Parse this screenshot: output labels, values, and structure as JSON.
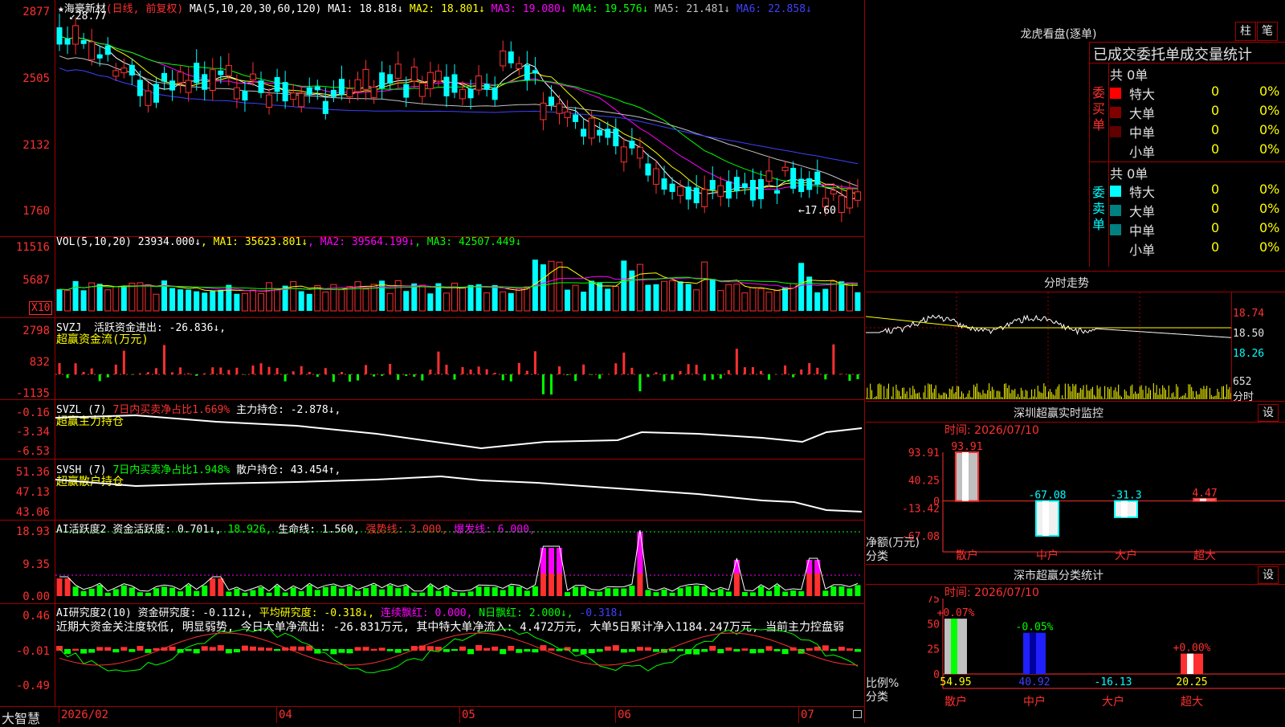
{
  "stock": {
    "name": "海豪新材",
    "period_note": "(日线, 前复权)",
    "star": "★"
  },
  "main_chart": {
    "ma_header": "MA(5,10,20,30,60,120)",
    "ma_values": [
      {
        "label": "MA1:",
        "value": "18.818↓",
        "color": "#ffffff"
      },
      {
        "label": "MA2:",
        "value": "18.801↓",
        "color": "#ffff00"
      },
      {
        "label": "MA3:",
        "value": "19.080↓",
        "color": "#ff00ff"
      },
      {
        "label": "MA4:",
        "value": "19.576↓",
        "color": "#00ff00"
      },
      {
        "label": "MA5:",
        "value": "21.481↓",
        "color": "#c0c0c0"
      },
      {
        "label": "MA6:",
        "value": "22.858↓",
        "color": "#4040ff"
      }
    ],
    "y_ticks": [
      "2877",
      "2505",
      "2132",
      "1760"
    ],
    "high_label": "28.77",
    "low_label": "17.60"
  },
  "vol_panel": {
    "header": "VOL(5,10,20)",
    "value": "23934.000↓",
    "ma": [
      {
        "label": "MA1:",
        "value": "35623.801↓",
        "color": "#ffff00"
      },
      {
        "label": "MA2:",
        "value": "39564.199↓",
        "color": "#ff00ff"
      },
      {
        "label": "MA3:",
        "value": "42507.449↓",
        "color": "#00ff00"
      }
    ],
    "y_ticks": [
      "11516",
      "5687"
    ],
    "unit": "X10"
  },
  "svzj_panel": {
    "header": "SVZJ",
    "line1": "活跃资金进出: -26.836↓,",
    "line2": "超赢资金流(万元)",
    "y_ticks": [
      "2798",
      "832",
      "-1135"
    ]
  },
  "svzl_panel": {
    "header": "SVZL (7)",
    "green_text": "7日内买卖净占比1.669%",
    "white_text": "主力持仓: -2.878↓,",
    "line2": "超赢主力持仓",
    "y_ticks": [
      "-0.16",
      "-3.34",
      "-6.53"
    ]
  },
  "svsh_panel": {
    "header": "SVSH (7)",
    "green_text": "7日内买卖净占比1.948%",
    "white_text": "散户持仓: 43.454↑,",
    "line2": "超赢散户持仓",
    "y_ticks": [
      "51.36",
      "47.13",
      "43.06"
    ]
  },
  "ai_active_panel": {
    "header": "AI活跃度2",
    "text1": "资金活跃度: 0.701↓,",
    "text1b": "18.926,",
    "text2": "生命线: 1.560,",
    "text3": "强势线: 3.000,",
    "text4": "爆发线: 6.000,",
    "y_ticks": [
      "18.93",
      "9.35",
      "0.00"
    ]
  },
  "ai_research_panel": {
    "header": "AI研究度2(10)",
    "text1": "资金研究度: -0.112↓,",
    "text2": "平均研究度: -0.318↓,",
    "text3": "连续飘红: 0.000,",
    "text4": "N日飘红: 2.000↓,",
    "text5": "-0.318↓",
    "comment": "近期大资金关注度较低, 明显弱势, 今日大单净流出: -26.831万元, 其中特大单净流入: 4.472万元, 大单5日累计净入1184.247万元, 当前主力控盘弱",
    "y_ticks": [
      "0.46",
      "-0.01",
      "-0.49"
    ]
  },
  "time_axis": {
    "brand": "大智慧",
    "labels": [
      "2026/02",
      "04",
      "05",
      "06",
      "07"
    ]
  },
  "dragon_tiger": {
    "title": "龙虎看盘(逐单)",
    "btn1": "柱",
    "btn2": "笔",
    "subtitle": "已成交委托单成交量统计",
    "buy": {
      "side_label": "委买单",
      "total": "共 0单",
      "rows": [
        {
          "label": "特大",
          "count": "0",
          "pct": "0%",
          "color": "#ff0000"
        },
        {
          "label": "大单",
          "count": "0",
          "pct": "0%",
          "color": "#800000"
        },
        {
          "label": "中单",
          "count": "0",
          "pct": "0%",
          "color": "#600000"
        },
        {
          "label": "小单",
          "count": "0",
          "pct": "0%",
          "color": ""
        }
      ]
    },
    "sell": {
      "side_label": "委卖单",
      "total": "共 0单",
      "rows": [
        {
          "label": "特大",
          "count": "0",
          "pct": "0%",
          "color": "#00ffff"
        },
        {
          "label": "大单",
          "count": "0",
          "pct": "0%",
          "color": "#008080"
        },
        {
          "label": "中单",
          "count": "0",
          "pct": "0%",
          "color": "#008080"
        },
        {
          "label": "小单",
          "count": "0",
          "pct": "0%",
          "color": ""
        }
      ]
    }
  },
  "intraday": {
    "title": "分时走势",
    "price_ticks": [
      "18.74",
      "18.50",
      "18.26"
    ],
    "vol_tick": "652",
    "vol_label": "分时"
  },
  "sz_monitor": {
    "title": "深圳超赢实时监控",
    "settings": "设",
    "date_label": "时间: 2026/07/10",
    "y_ticks": [
      "93.91",
      "40.25",
      "0",
      "-13.42",
      "-67.08"
    ],
    "axis_title": "净额(万元)",
    "axis_sub": "分类",
    "bars": [
      {
        "name": "散户",
        "value": 93.91,
        "label": "93.91"
      },
      {
        "name": "中户",
        "value": -67.08,
        "label": "-67.08"
      },
      {
        "name": "大户",
        "value": -31.3,
        "label": "-31.3"
      },
      {
        "name": "超大",
        "value": 4.47,
        "label": "4.47"
      }
    ]
  },
  "sz_class": {
    "title": "深市超赢分类统计",
    "settings": "设",
    "date_label": "时间: 2026/07/10",
    "y_ticks": [
      "75",
      "50",
      "25",
      "0"
    ],
    "axis_title": "比例%",
    "axis_sub": "分类",
    "bars": [
      {
        "name": "散户",
        "change": "+0.07%",
        "value": 54.95,
        "label": "54.95"
      },
      {
        "name": "中户",
        "change": "-0.05%",
        "value": 40.92,
        "label": "40.92"
      },
      {
        "name": "大户",
        "change": "",
        "value": -16.13,
        "label": "-16.13"
      },
      {
        "name": "超大",
        "change": "+0.00%",
        "value": 20.25,
        "label": "20.25"
      }
    ]
  }
}
